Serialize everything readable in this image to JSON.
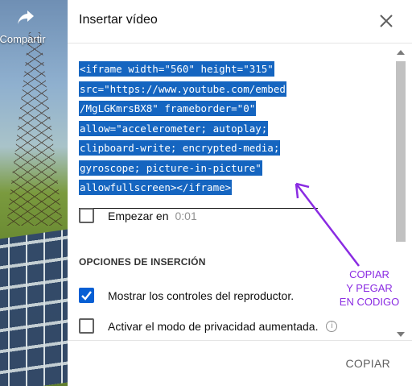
{
  "background": {
    "share_label": "Compartir"
  },
  "dialog": {
    "title": "Insertar vídeo",
    "embed_code_lines": [
      "<iframe width=\"560\" height=\"315\"",
      "src=\"https://www.youtube.com/embed",
      "/MgLGKmrsBX8\" frameborder=\"0\"",
      "allow=\"accelerometer; autoplay;",
      "clipboard-write; encrypted-media;",
      "gyroscope; picture-in-picture\"",
      "allowfullscreen></iframe>"
    ],
    "start_at": {
      "label": "Empezar en",
      "time": "0:01",
      "checked": false
    },
    "options_title": "OPCIONES DE INSERCIÓN",
    "options": [
      {
        "label": "Mostrar los controles del reproductor.",
        "checked": true
      },
      {
        "label": "Activar el modo de privacidad aumentada.",
        "checked": false
      }
    ],
    "copy_button": "COPIAR",
    "accent_color": "#065fd4",
    "selection_color": "#1565c0"
  },
  "annotation": {
    "lines": [
      "COPIAR",
      "Y PEGAR",
      "EN CODIGO"
    ],
    "color": "#8a2be2"
  }
}
